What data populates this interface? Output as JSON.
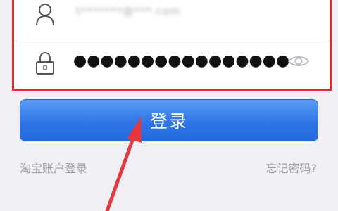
{
  "login_form": {
    "username": {
      "icon": "user-icon",
      "value": "t*******@***.com"
    },
    "password": {
      "icon": "lock-icon",
      "value": "●●●●●●●●●●●●●●●●",
      "visibility_icon": "eye-icon"
    }
  },
  "actions": {
    "login_label": "登录",
    "taobao_login_label": "淘宝账户登录",
    "forgot_password_label": "忘记密码?"
  },
  "annotation": {
    "highlight_color": "#e3262d",
    "arrow_color": "#e8363f",
    "arrow_target": "login-button"
  },
  "colors": {
    "button": "#2f75e6",
    "background": "#efeff4"
  }
}
